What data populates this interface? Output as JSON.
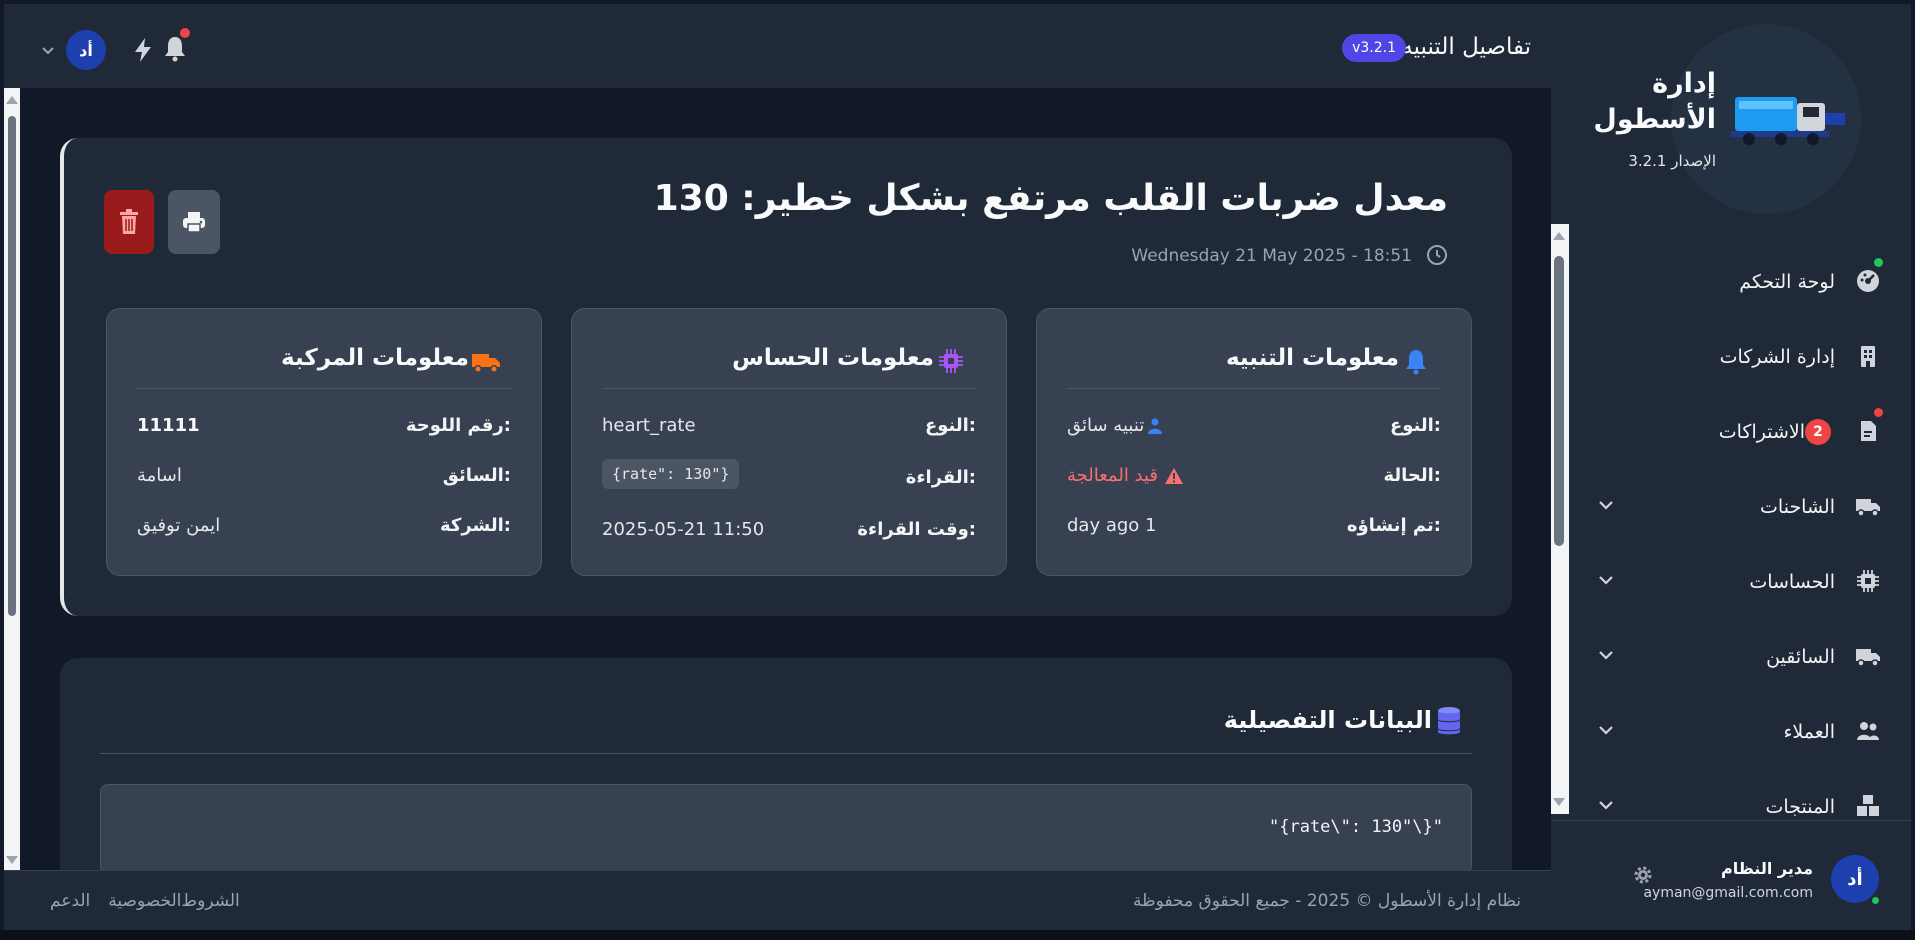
{
  "topbar": {
    "title": "تفاصيل التنبيه",
    "version_badge": "v3.2.1",
    "avatar_initials": "أد"
  },
  "sidebar": {
    "brand_title_line1": "إدارة",
    "brand_title_line2": "الأسطول",
    "brand_version": "الإصدار 3.2.1",
    "items": [
      {
        "label": "لوحة التحكم",
        "icon": "gauge-icon"
      },
      {
        "label": "إدارة الشركات",
        "icon": "building-icon"
      },
      {
        "label": "الاشتراكات",
        "icon": "document-icon",
        "badge": "2"
      },
      {
        "label": "الشاحنات",
        "icon": "truck-icon"
      },
      {
        "label": "الحساسات",
        "icon": "chip-icon"
      },
      {
        "label": "السائقين",
        "icon": "truck-icon"
      },
      {
        "label": "العملاء",
        "icon": "users-icon"
      },
      {
        "label": "المنتجات",
        "icon": "boxes-icon"
      }
    ],
    "user": {
      "initials": "أد",
      "name": "مدير النظام",
      "email": "ayman@gmail.com.com"
    }
  },
  "alert": {
    "title": "معدل ضربات القلب مرتفع بشكل خطير: 130",
    "datetime": "Wednesday 21 May 2025 - 18:51"
  },
  "alert_info": {
    "heading": "معلومات التنبيه",
    "type_label": "النوع:",
    "type_value": "تنبيه سائق",
    "status_label": "الحالة:",
    "status_value": "قيد المعالجة",
    "created_label": "تم إنشاؤه:",
    "created_value": "day ago 1"
  },
  "sensor_info": {
    "heading": "معلومات الحساس",
    "type_label": "النوع:",
    "type_value": "heart_rate",
    "reading_label": "القراءة:",
    "reading_value": "{rate\": 130\"}",
    "reading_time_label": "وقت القراءة:",
    "reading_time_value": "2025-05-21 11:50"
  },
  "vehicle_info": {
    "heading": "معلومات المركبة",
    "plate_label": "رقم اللوحة:",
    "plate_value": "11111",
    "driver_label": "السائق:",
    "driver_value": "اسامة",
    "company_label": "الشركة:",
    "company_value": "ايمن توفيق"
  },
  "details": {
    "heading": "البيانات التفصيلية",
    "raw": "\"{rate\\\": 130\"\\}\""
  },
  "footer": {
    "copyright": "نظام إدارة الأسطول © 2025 - جميع الحقوق محفوظة",
    "links": [
      "الشروط",
      "الخصوصية",
      "الدعم"
    ]
  },
  "colors": {
    "accent": "#4f46e5",
    "danger": "#ef4444",
    "success": "#22c55e",
    "sensor_icon": "#a855f7",
    "vehicle_icon": "#f97316",
    "alert_icon": "#3b82f6"
  }
}
